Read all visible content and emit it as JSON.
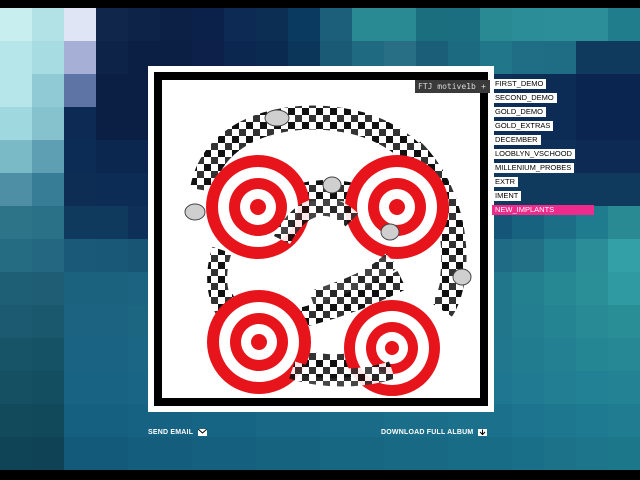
{
  "window": {
    "title": "FTJ motive1b",
    "title_button": "+"
  },
  "tracks": [
    {
      "label": "FIRST_DEMO",
      "active": false
    },
    {
      "label": "SECOND_DEMO",
      "active": false
    },
    {
      "label": "GOLD_DEMO",
      "active": false
    },
    {
      "label": "GOLD_EXTRAS",
      "active": false
    },
    {
      "label": "DECEMBER",
      "active": false
    },
    {
      "label": "LOOBLYN_VSCHOOD",
      "active": false
    },
    {
      "label": "MILLENIUM_PROBES",
      "active": false
    },
    {
      "label": "EXTR",
      "active": false
    },
    {
      "label": "IMENT",
      "active": false
    },
    {
      "label": "NEW_IMPLANTS",
      "active": true
    }
  ],
  "footer": {
    "send_email": "SEND EMAIL",
    "download": "DOWNLOAD FULL ALBUM",
    "send_email_icon": "envelope-icon",
    "download_icon": "download-icon"
  },
  "colors": {
    "accent": "#ee2b8c",
    "target_red": "#e8141c",
    "background_teal": "#1b6f86"
  },
  "mosaic": [
    "#c8eef0",
    "#b2e1e6",
    "#dfe5f5",
    "#10264a",
    "#0e2348",
    "#0c1f44",
    "#0b2149",
    "#0d2a55",
    "#0b2e52",
    "#0a3a60",
    "#1b5f7a",
    "#2a8a93",
    "#2a8a93",
    "#1a6e7e",
    "#1a6e80",
    "#2a8a93",
    "#2a8d97",
    "#2b8e99",
    "#2b8e99",
    "#1f7d8c",
    "#b7e6ea",
    "#a7dce2",
    "#a6b0d6",
    "#0d2347",
    "#0b1f45",
    "#0b1f45",
    "#0c2049",
    "#0b264f",
    "#0b2a4f",
    "#0c355a",
    "#1a5a75",
    "#1f6a80",
    "#286f86",
    "#1b5e77",
    "#1b6a80",
    "#22768a",
    "#1f6e86",
    "#1f6d85",
    "#0f3a5e",
    "#0f3a5e",
    "#b7e6ea",
    "#8fcad5",
    "#5e74a5",
    "#0b1f45",
    "#0b1f45",
    "#0c2049",
    "#0b2550",
    "#0b2a52",
    "#0b2e57",
    "#0d2f57",
    "#0c2c55",
    "#0f3a5e",
    "#0f3a5e",
    "#0f3a5e",
    "#0c2c55",
    "#0e2f58",
    "#0d2d55",
    "#0c2c55",
    "#0a2550",
    "#0a2550",
    "#9fd8de",
    "#85c2cd",
    "#0d2a55",
    "#0b1f45",
    "#0b1f45",
    "#0b2249",
    "#0a2550",
    "#0b264f",
    "#0b2a55",
    "#0b2a55",
    "#0c2c55",
    "#0c2c55",
    "#0c2c55",
    "#0d2d55",
    "#0e2f58",
    "#0e2f58",
    "#0c2c55",
    "#0c2c55",
    "#0a2550",
    "#0a2550",
    "#7ab9c6",
    "#5f9fb3",
    "#0c2c55",
    "#0b264f",
    "#0b264f",
    "#0a2550",
    "#0b264f",
    "#0b2a55",
    "#0c2c55",
    "#0c2c55",
    "#0d2d55",
    "#0d2d55",
    "#0d2d55",
    "#0e2f58",
    "#0e2f58",
    "#0e2f58",
    "#0e2f58",
    "#0e2f58",
    "#0d2a55",
    "#0d2a55",
    "#4f8fa6",
    "#387d96",
    "#0d2d55",
    "#0c2c55",
    "#0c2c55",
    "#0b2a55",
    "#0c2c55",
    "#0d2d55",
    "#0e2f58",
    "#0e2f58",
    "#0f3a5e",
    "#0f3a5e",
    "#0f3a5e",
    "#0f3a5e",
    "#0f3a5e",
    "#0f3a5e",
    "#0f3a5e",
    "#0f3a5e",
    "#0f3a5e",
    "#0f3a5e",
    "#2d7489",
    "#2a7086",
    "#0f3a5e",
    "#0f3a5e",
    "#0e2f58",
    "#0e2f58",
    "#0f3a5e",
    "#0f3a5e",
    "#104065",
    "#104065",
    "#12476d",
    "#12476d",
    "#124d72",
    "#134f74",
    "#155578",
    "#155578",
    "#17627f",
    "#1b6e86",
    "#1f7c8e",
    "#2a8a93",
    "#256c82",
    "#236880",
    "#1a5a78",
    "#195876",
    "#185574",
    "#185574",
    "#195876",
    "#1a5a78",
    "#1b5e7a",
    "#1b5e7a",
    "#1c627e",
    "#1c627e",
    "#1d6682",
    "#1d6682",
    "#1f6a84",
    "#1f6a84",
    "#217086",
    "#238090",
    "#2a8d97",
    "#33a0a8",
    "#1f5f76",
    "#1e5d74",
    "#1b627e",
    "#1b627e",
    "#1b6380",
    "#1b6380",
    "#1c6682",
    "#1c6682",
    "#1d6984",
    "#1d6984",
    "#1e6c86",
    "#1e6c86",
    "#1f6f88",
    "#1f6f88",
    "#21768c",
    "#21768c",
    "#23808f",
    "#268892",
    "#2a8f97",
    "#2f9aa1",
    "#1b5a70",
    "#1a586e",
    "#1b6380",
    "#1b6380",
    "#1c6682",
    "#1c6682",
    "#1d6984",
    "#1d6984",
    "#1d6a85",
    "#1d6a85",
    "#1e6d87",
    "#1e6d87",
    "#1f7089",
    "#1f7089",
    "#21768c",
    "#21768c",
    "#237e8f",
    "#258491",
    "#288a94",
    "#2a8e97",
    "#175468",
    "#165266",
    "#1a6382",
    "#1a6382",
    "#1b6684",
    "#1b6684",
    "#1b6886",
    "#1b6886",
    "#1c6b88",
    "#1c6b88",
    "#1d6e8a",
    "#1d6e8a",
    "#1e718c",
    "#1e718c",
    "#20778e",
    "#20778e",
    "#227c90",
    "#238092",
    "#258693",
    "#268894",
    "#144f62",
    "#134d60",
    "#186384",
    "#186384",
    "#196586",
    "#196586",
    "#1a6888",
    "#1a6888",
    "#1b6b8a",
    "#1b6b8a",
    "#1c6e8c",
    "#1c6e8c",
    "#1d718e",
    "#1d718e",
    "#1f7690",
    "#1f7690",
    "#207a92",
    "#217e93",
    "#228194",
    "#238395",
    "#124a5c",
    "#11485a",
    "#155f80",
    "#155f80",
    "#166282",
    "#166282",
    "#176584",
    "#176584",
    "#186886",
    "#186886",
    "#196b88",
    "#196b88",
    "#1a6e8a",
    "#1a6e8a",
    "#1b718c",
    "#1b718c",
    "#1c748e",
    "#1d778f",
    "#1e7a90",
    "#1f7c91",
    "#0f4456",
    "#0e4254",
    "#135a7a",
    "#135a7a",
    "#145d7c",
    "#145d7c",
    "#15607e",
    "#15607e",
    "#166380",
    "#166380",
    "#176682",
    "#176682",
    "#186984",
    "#186984",
    "#196c86",
    "#196c86",
    "#1a6f88",
    "#1b7289",
    "#1c758a",
    "#1d778b"
  ]
}
